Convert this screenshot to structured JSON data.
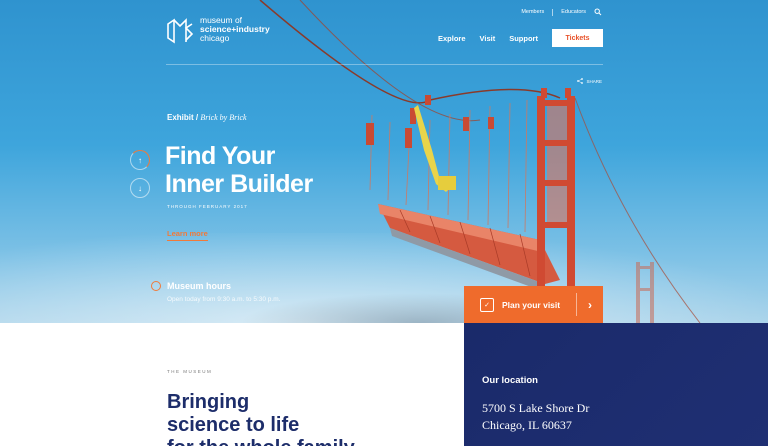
{
  "brand": {
    "line1": "museum of",
    "line2": "science+industry",
    "line3": "chicago",
    "colors": {
      "accent": "#ef6b2c",
      "navy": "#1f2f73",
      "sky": "#3ea5dc"
    }
  },
  "util_nav": {
    "members": "Members",
    "educators": "Educators",
    "search_icon": "search-icon"
  },
  "main_nav": {
    "explore": "Explore",
    "visit": "Visit",
    "support": "Support",
    "tickets": "Tickets"
  },
  "share": {
    "label": "SHARE"
  },
  "hero": {
    "eyebrow_prefix": "Exhibit /",
    "eyebrow_italic": "Brick by Brick",
    "headline_line1": "Find Your",
    "headline_line2": "Inner Builder",
    "through": "THROUGH FEBRUARY 2017",
    "learn_more": "Learn more"
  },
  "hours": {
    "title": "Museum hours",
    "text": "Open today from 9:30 a.m. to 5:30 p.m."
  },
  "plan_visit": {
    "label": "Plan your visit"
  },
  "location": {
    "title": "Our location",
    "address_line1": "5700 S Lake Shore Dr",
    "address_line2": "Chicago, IL 60637"
  },
  "museum": {
    "label": "THE MUSEUM",
    "headline_line1": "Bringing",
    "headline_line2": "science to life",
    "headline_line3": "for the whole family"
  }
}
